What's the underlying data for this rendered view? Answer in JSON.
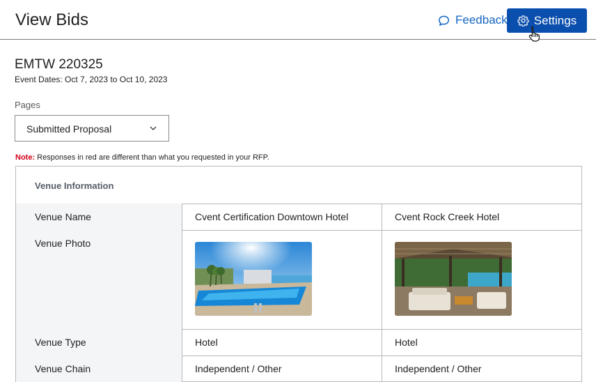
{
  "header": {
    "title": "View Bids",
    "feedback_label": "Feedback",
    "settings_label": "Settings"
  },
  "event": {
    "name": "EMTW 220325",
    "dates": "Event Dates: Oct 7, 2023 to Oct 10, 2023"
  },
  "pages": {
    "label": "Pages",
    "selected": "Submitted Proposal"
  },
  "note": {
    "label": "Note:",
    "text": " Responses in red are different than what you requested in your RFP."
  },
  "table": {
    "section_title": "Venue Information",
    "rows": [
      {
        "label": "Venue Name",
        "values": [
          "Cvent Certification Downtown Hotel",
          "Cvent Rock Creek Hotel"
        ]
      },
      {
        "label": "Venue Photo",
        "values": [
          "",
          ""
        ]
      },
      {
        "label": "Venue Type",
        "values": [
          "Hotel",
          "Hotel"
        ]
      },
      {
        "label": "Venue Chain",
        "values": [
          "Independent / Other",
          "Independent / Other"
        ]
      }
    ]
  },
  "colors": {
    "accent": "#0b4fae",
    "link": "#1565c0",
    "note_red": "#d0021b"
  }
}
